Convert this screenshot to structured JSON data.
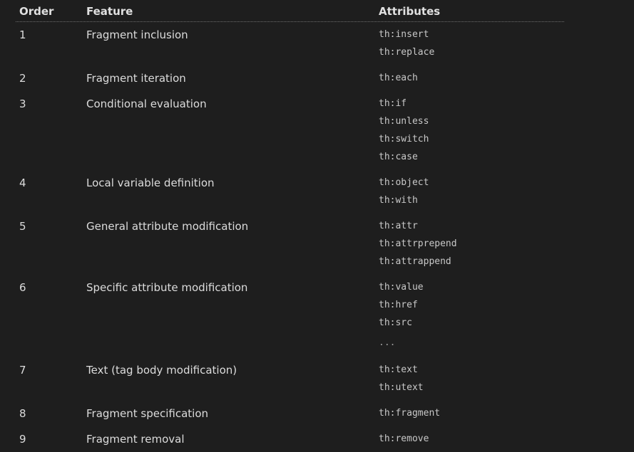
{
  "headers": {
    "order": "Order",
    "feature": "Feature",
    "attributes": "Attributes"
  },
  "rows": [
    {
      "order": "1",
      "feature": "Fragment inclusion",
      "attributes": [
        "th:insert",
        "th:replace"
      ]
    },
    {
      "order": "2",
      "feature": "Fragment iteration",
      "attributes": [
        "th:each"
      ]
    },
    {
      "order": "3",
      "feature": "Conditional evaluation",
      "attributes": [
        "th:if",
        "th:unless",
        "th:switch",
        "th:case"
      ]
    },
    {
      "order": "4",
      "feature": "Local variable definition",
      "attributes": [
        "th:object",
        "th:with"
      ]
    },
    {
      "order": "5",
      "feature": "General attribute modification",
      "attributes": [
        "th:attr",
        "th:attrprepend",
        "th:attrappend"
      ]
    },
    {
      "order": "6",
      "feature": "Specific attribute modification",
      "attributes": [
        "th:value",
        "th:href",
        "th:src",
        "..."
      ]
    },
    {
      "order": "7",
      "feature": "Text (tag body modification)",
      "attributes": [
        "th:text",
        "th:utext"
      ]
    },
    {
      "order": "8",
      "feature": "Fragment specification",
      "attributes": [
        "th:fragment"
      ]
    },
    {
      "order": "9",
      "feature": "Fragment removal",
      "attributes": [
        "th:remove"
      ]
    }
  ]
}
